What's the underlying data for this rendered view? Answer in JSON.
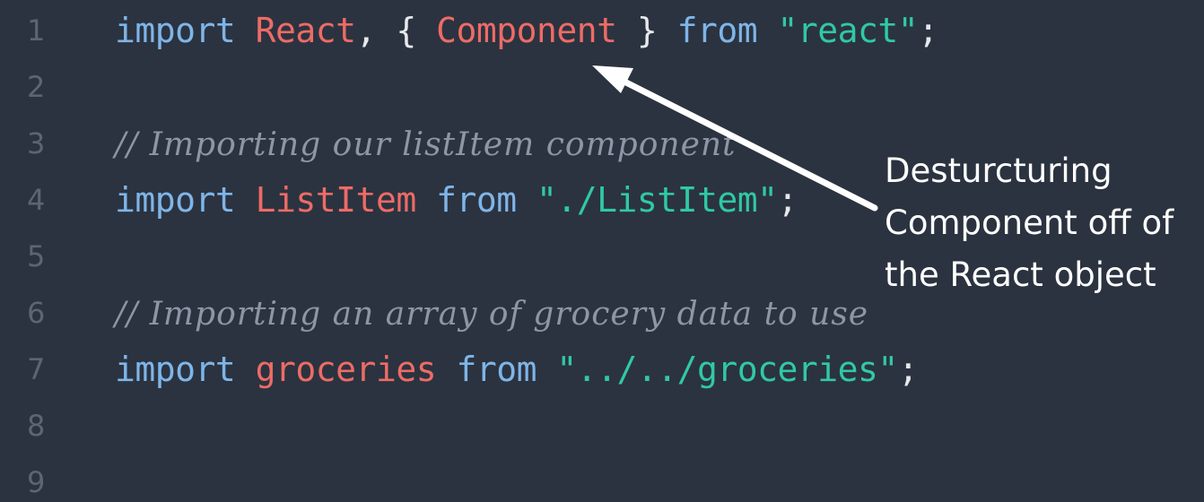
{
  "editor": {
    "lines": [
      {
        "number": "1",
        "tokens": [
          {
            "t": "import",
            "k": "kw"
          },
          {
            "t": " ",
            "k": "pun"
          },
          {
            "t": "React",
            "k": "id"
          },
          {
            "t": ", { ",
            "k": "pun"
          },
          {
            "t": "Component",
            "k": "id"
          },
          {
            "t": " } ",
            "k": "pun"
          },
          {
            "t": "from",
            "k": "kw"
          },
          {
            "t": " ",
            "k": "pun"
          },
          {
            "t": "\"react\"",
            "k": "str"
          },
          {
            "t": ";",
            "k": "pun"
          }
        ]
      },
      {
        "number": "2",
        "tokens": []
      },
      {
        "number": "3",
        "tokens": [
          {
            "t": "// Importing our listItem component",
            "k": "cmt"
          }
        ]
      },
      {
        "number": "4",
        "tokens": [
          {
            "t": "import",
            "k": "kw"
          },
          {
            "t": " ",
            "k": "pun"
          },
          {
            "t": "ListItem",
            "k": "id"
          },
          {
            "t": " ",
            "k": "pun"
          },
          {
            "t": "from",
            "k": "kw"
          },
          {
            "t": " ",
            "k": "pun"
          },
          {
            "t": "\"./ListItem\"",
            "k": "str"
          },
          {
            "t": ";",
            "k": "pun"
          }
        ]
      },
      {
        "number": "5",
        "tokens": []
      },
      {
        "number": "6",
        "tokens": [
          {
            "t": "// Importing an array of grocery data to use",
            "k": "cmt"
          }
        ]
      },
      {
        "number": "7",
        "tokens": [
          {
            "t": "import",
            "k": "kw"
          },
          {
            "t": " ",
            "k": "pun"
          },
          {
            "t": "groceries",
            "k": "id"
          },
          {
            "t": " ",
            "k": "pun"
          },
          {
            "t": "from",
            "k": "kw"
          },
          {
            "t": " ",
            "k": "pun"
          },
          {
            "t": "\"../../groceries\"",
            "k": "str"
          },
          {
            "t": ";",
            "k": "pun"
          }
        ]
      },
      {
        "number": "8",
        "tokens": []
      },
      {
        "number": "9",
        "tokens": []
      }
    ]
  },
  "annotation": {
    "line1": "Desturcturing",
    "line2": "Component off of",
    "line3": "the React object"
  },
  "colors": {
    "background": "#2b3340",
    "keyword": "#7fb5e8",
    "identifier": "#ee6b66",
    "string": "#30c9a4",
    "comment": "#8d96a6",
    "line_number": "#5c6573",
    "annotation_text": "#ffffff"
  }
}
